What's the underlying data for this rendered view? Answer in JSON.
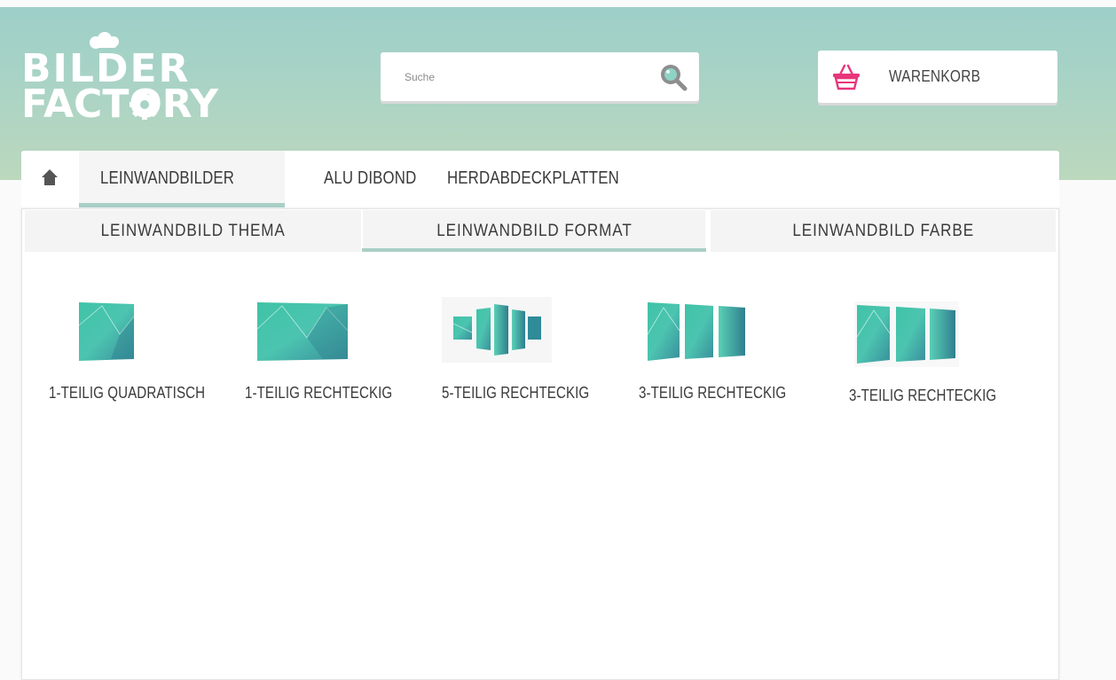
{
  "brand": {
    "logo_text_line1": "BILDER",
    "logo_text_line2": "FACTORY",
    "logo_color": "#ffffff"
  },
  "colors": {
    "header_gradient_top": "#9ccfc8",
    "header_gradient_bottom": "#bcd8bd",
    "accent_teal": "#a9cfc6",
    "cart_icon": "#e8357a",
    "search_icon": "#8fd3c4"
  },
  "search": {
    "placeholder": "Suche",
    "icon": "search-icon"
  },
  "cart": {
    "label": "WARENKORB",
    "icon": "basket-icon"
  },
  "nav": {
    "home_icon": "home-icon",
    "items": [
      {
        "label": "LEINWANDBILDER",
        "active": true
      },
      {
        "label": "ALU DIBOND",
        "active": false
      },
      {
        "label": "HERDABDECKPLATTEN",
        "active": false
      }
    ]
  },
  "subtabs": [
    {
      "label": "LEINWANDBILD THEMA",
      "active": false
    },
    {
      "label": "LEINWANDBILD FORMAT",
      "active": true
    },
    {
      "label": "LEINWANDBILD FARBE",
      "active": false
    }
  ],
  "products": [
    {
      "label": "1-TEILIG QUADRATISCH",
      "panels": 1,
      "shape": "square"
    },
    {
      "label": "1-TEILIG RECHTECKIG",
      "panels": 1,
      "shape": "landscape"
    },
    {
      "label": "5-TEILIG RECHTECKIG",
      "panels": 5,
      "shape": "staggered"
    },
    {
      "label": "3-TEILIG RECHTECKIG",
      "panels": 3,
      "shape": "equal"
    },
    {
      "label": "3-TEILIG RECHTECKIG",
      "panels": 3,
      "shape": "equal"
    }
  ]
}
